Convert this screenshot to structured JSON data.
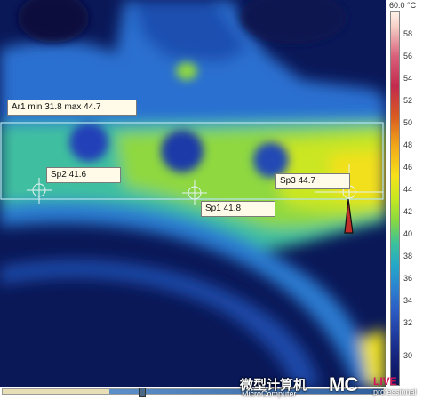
{
  "measurements": {
    "area": "Ar1 min 31.8 max 44.7",
    "spots": [
      {
        "text": "Sp2 41.6"
      },
      {
        "text": "Sp1 41.8"
      },
      {
        "text": "Sp3 44.7"
      }
    ]
  },
  "scale": {
    "max_label": "60.0 °C",
    "ticks": [
      "58",
      "56",
      "54",
      "52",
      "50",
      "48",
      "46",
      "44",
      "42",
      "40",
      "38",
      "36",
      "34",
      "32",
      "30"
    ]
  },
  "watermark": {
    "chinese": "微型计算机",
    "english": "MicroComputer",
    "logo": "MC",
    "live": "LIVE",
    "professional": "professional"
  },
  "colors": {
    "background_cold": "#05124a",
    "hot_yellow": "#f6e21a",
    "warm_green": "#88d840",
    "mid_blue": "#2c82d0"
  }
}
